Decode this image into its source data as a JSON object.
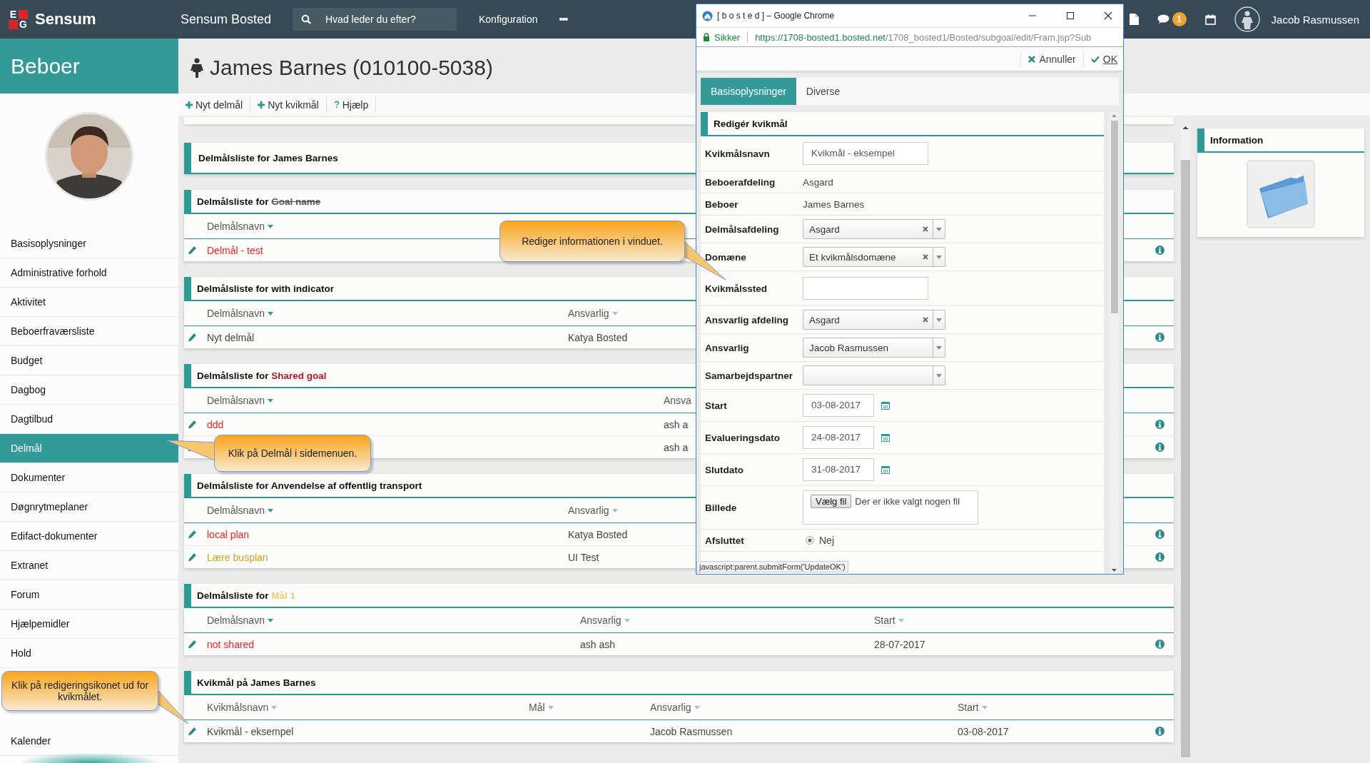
{
  "topbar": {
    "logo": [
      "E",
      "G"
    ],
    "brand": "Sensum",
    "app": "Sensum Bosted",
    "search": {
      "placeholder": "Hvad leder du efter?"
    },
    "menu": "Konfiguration",
    "more": "•••",
    "notifications": "1",
    "user": "Jacob Rasmussen"
  },
  "sidebar": {
    "title": "Beboer",
    "items": [
      {
        "label": "Basisoplysninger",
        "selected": false
      },
      {
        "label": "Administrative forhold",
        "selected": false
      },
      {
        "label": "Aktivitet",
        "selected": false
      },
      {
        "label": "Beboerfraværsliste",
        "selected": false
      },
      {
        "label": "Budget",
        "selected": false
      },
      {
        "label": "Dagbog",
        "selected": false
      },
      {
        "label": "Dagtilbud",
        "selected": false
      },
      {
        "label": "Delmål",
        "selected": true
      },
      {
        "label": "Dokumenter",
        "selected": false
      },
      {
        "label": "Døgnrytmeplaner",
        "selected": false
      },
      {
        "label": "Edifact-dokumenter",
        "selected": false
      },
      {
        "label": "Extranet",
        "selected": false
      },
      {
        "label": "Forum",
        "selected": false
      },
      {
        "label": "Hjælpemidler",
        "selected": false
      },
      {
        "label": "Hold",
        "selected": false
      },
      {
        "label": "Kalender",
        "selected": false
      }
    ]
  },
  "page": {
    "title": "James Barnes (010100-5038)",
    "actions": [
      {
        "kind": "add",
        "label": "Nyt delmål"
      },
      {
        "kind": "add",
        "label": "Nyt kvikmål"
      },
      {
        "kind": "help",
        "label": "Hjælp"
      }
    ]
  },
  "panels": [
    {
      "title": "Delmålsliste for",
      "subject": {
        "text": "James Barnes",
        "color": "#111111",
        "struck": false
      }
    },
    {
      "title": "Delmålsliste for",
      "subject": {
        "text": "Goal name",
        "color": "#555555",
        "struck": true
      },
      "columns": [
        {
          "label": "Delmålsnavn",
          "sorted": true
        }
      ],
      "rows": [
        {
          "cells": [
            "Delmål - test"
          ],
          "color": "#ee2222"
        }
      ]
    },
    {
      "title": "Delmålsliste for",
      "subject": {
        "text": "with indicator",
        "color": "#111111",
        "struck": false
      },
      "columns": [
        {
          "label": "Delmålsnavn",
          "sorted": true
        },
        {
          "label": "Ansvarlig",
          "sorted": false
        }
      ],
      "rows": [
        {
          "cells": [
            "Nyt delmål",
            "Katya Bosted"
          ],
          "color": "#444444"
        }
      ]
    },
    {
      "title": "Delmålsliste for",
      "subject": {
        "text": "Shared goal",
        "color": "#b0182a",
        "struck": false
      },
      "columns": [
        {
          "label": "Delmålsnavn",
          "sorted": true
        },
        {
          "label": "Ansva"
        }
      ],
      "rows": [
        {
          "cells": [
            "ddd",
            "ash a"
          ],
          "color": "#ee2222"
        },
        {
          "cells": [
            null,
            "ash a"
          ]
        }
      ]
    },
    {
      "title": "Delmålsliste for",
      "subject": {
        "text": "Anvendelse af offentlig transport",
        "color": "#111111",
        "struck": false
      },
      "columns": [
        {
          "label": "Delmålsnavn",
          "sorted": true
        },
        {
          "label": "Ansvarlig",
          "sorted": false
        }
      ],
      "rows": [
        {
          "cells": [
            "local plan",
            "Katya Bosted"
          ],
          "color": "#ee2222"
        },
        {
          "cells": [
            "Lære busplan",
            "UI Test"
          ],
          "color": "#d4a020"
        }
      ]
    },
    {
      "title": "Delmålsliste for",
      "subject": {
        "text": "Mål 1",
        "color": "#f0cc70",
        "struck": false
      },
      "columns": [
        {
          "label": "Delmålsnavn",
          "sorted": true
        },
        {
          "label": "Ansvarlig",
          "sorted": false
        },
        {
          "label": "Start",
          "sorted": false
        }
      ],
      "rows": [
        {
          "cells": [
            "not shared",
            "ash ash",
            "28-07-2017"
          ],
          "color": "#ee2222"
        }
      ]
    },
    {
      "title": "Kvikmål på James Barnes",
      "columns": [
        {
          "label": "Kvikmålsnavn",
          "sorted": false
        },
        {
          "label": "Mål",
          "sorted": false
        },
        {
          "label": "Ansvarlig",
          "sorted": false
        },
        {
          "label": "Start",
          "sorted": false
        }
      ],
      "rows": [
        {
          "cells": [
            "Kvikmål - eksempel",
            null,
            "Jacob Rasmussen",
            "03-08-2017"
          ],
          "color": "#444444"
        }
      ]
    }
  ],
  "info_panel": {
    "title": "Information"
  },
  "popup": {
    "window_title": "[ b o s t e d ] – Google Chrome",
    "secure_label": "Sikker",
    "url_host": "https://1708-bosted1.bosted.net",
    "url_path": "/1708_bosted1/Bosted/subgoal/edit/Fram.jsp?Sub",
    "actions": [
      {
        "kind": "cancel",
        "label": "Annuller"
      },
      {
        "kind": "ok",
        "label": "OK"
      }
    ],
    "tabs": [
      {
        "label": "Basisoplysninger",
        "selected": true
      },
      {
        "label": "Diverse",
        "selected": false
      }
    ],
    "section": "Redigér kvikmål",
    "fields": [
      {
        "label": "Kvikmålsnavn",
        "kind": "input",
        "value": "Kvikmål - eksempel"
      },
      {
        "label": "Beboerafdeling",
        "kind": "text",
        "value": "Asgard"
      },
      {
        "label": "Beboer",
        "kind": "text",
        "value": "James Barnes"
      },
      {
        "label": "Delmålsafdeling",
        "kind": "select",
        "value": "Asgard",
        "clearable": true
      },
      {
        "label": "Domæne",
        "kind": "select",
        "value": "Et kvikmålsdomæne",
        "clearable": true
      },
      {
        "label": "Kvikmålssted",
        "kind": "input"
      },
      {
        "label": "Ansvarlig afdeling",
        "kind": "select",
        "value": "Asgard",
        "clearable": true
      },
      {
        "label": "Ansvarlig",
        "kind": "select",
        "value": "Jacob Rasmussen",
        "clearable": false
      },
      {
        "label": "Samarbejdspartner",
        "kind": "select",
        "clearable": false
      },
      {
        "label": "Start",
        "kind": "date",
        "value": "03-08-2017"
      },
      {
        "label": "Evalueringsdato",
        "kind": "date",
        "value": "24-08-2017"
      },
      {
        "label": "Slutdato",
        "kind": "date",
        "value": "31-08-2017"
      },
      {
        "label": "Billede",
        "kind": "file",
        "button": "Vælg fil",
        "value": "Der er ikke valgt nogen fil"
      },
      {
        "label": "Afsluttet",
        "kind": "radio",
        "options": [
          {
            "label": "Nej",
            "selected": true
          }
        ]
      }
    ],
    "status_text": "javascript:parent.submitForm('UpdateOK')"
  },
  "callouts": [
    {
      "text": "Rediger informationen i vinduet."
    },
    {
      "text": "Klik på Delmål i sidemenuen."
    },
    {
      "text": "Klik på redigeringsikonet ud for kvikmålet."
    }
  ]
}
